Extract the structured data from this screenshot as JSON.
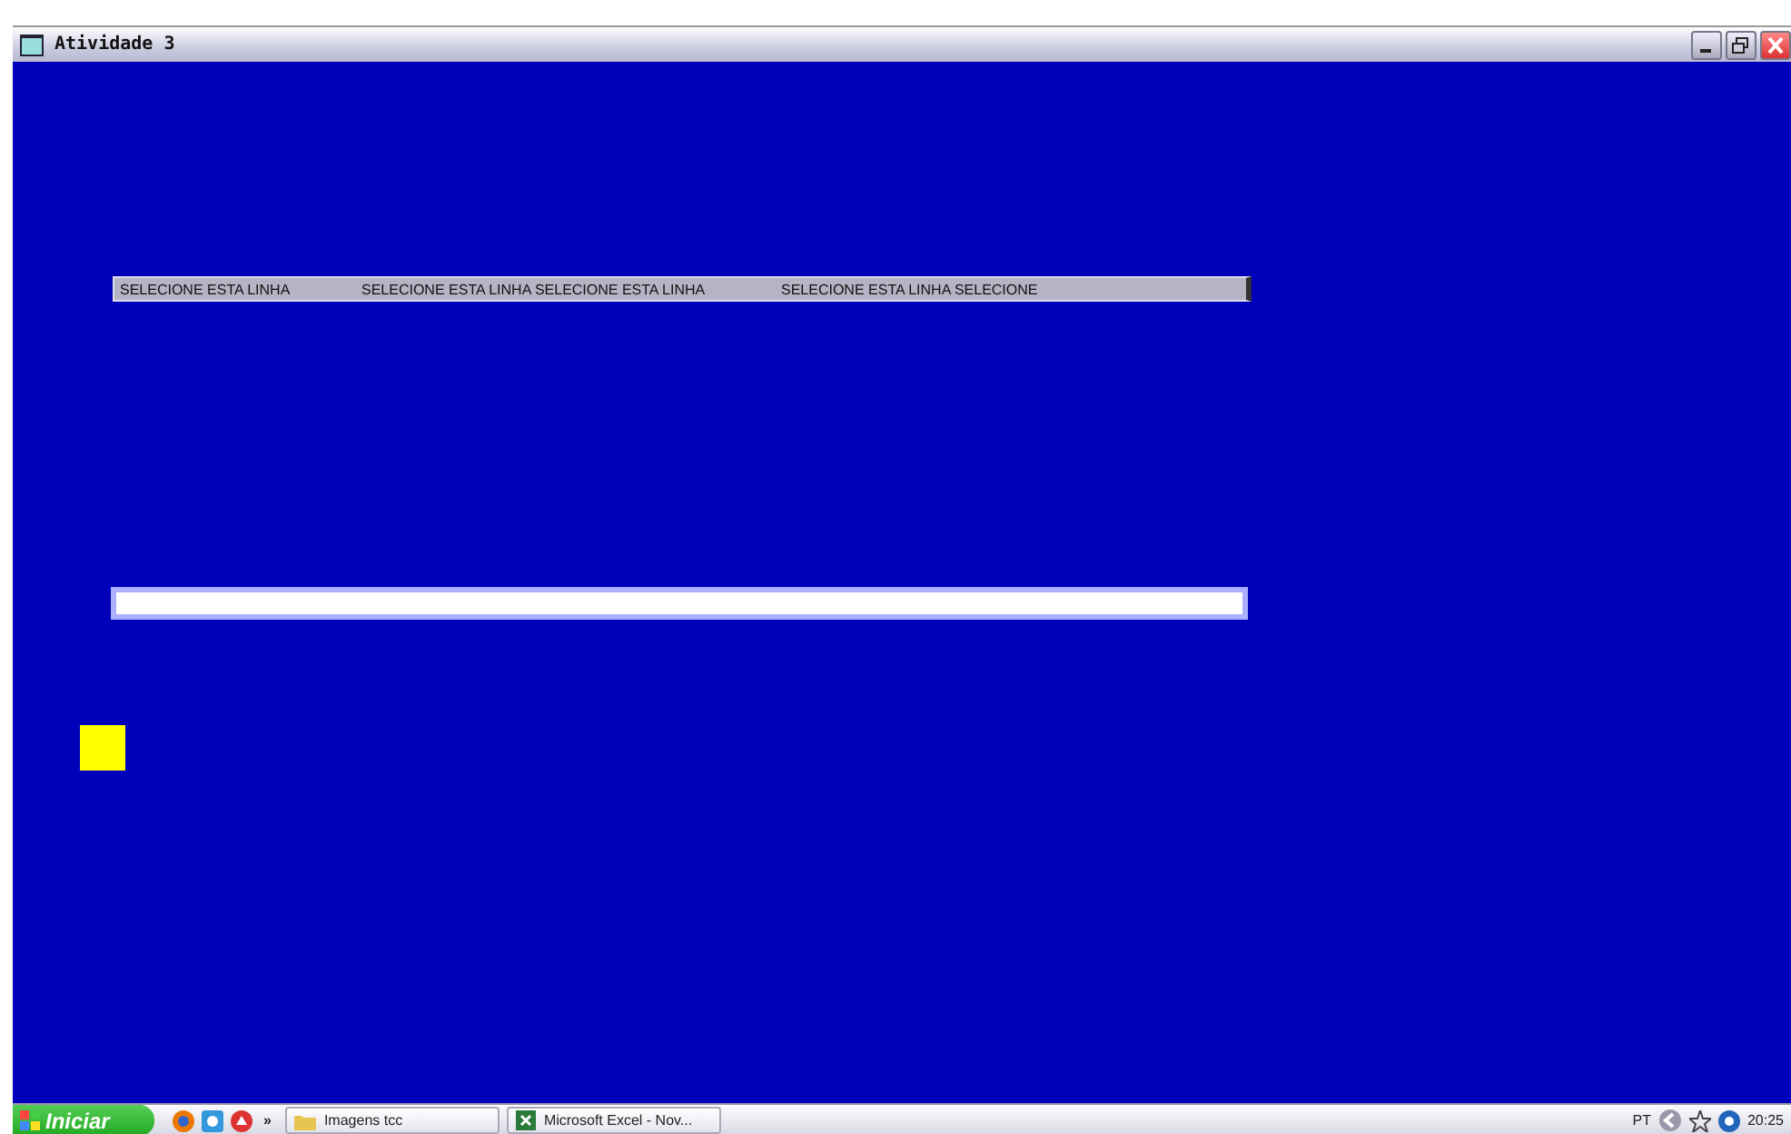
{
  "window": {
    "title": "Atividade 3"
  },
  "line": {
    "segments": [
      "SELECIONE ESTA LINHA",
      "SELECIONE ESTA LINHA SELECIONE ESTA LINHA",
      "SELECIONE ESTA LINHA SELECIONE"
    ]
  },
  "taskbar": {
    "start": "Iniciar",
    "overflow": "»",
    "tasks": [
      {
        "label": "Imagens tcc",
        "kind": "folder"
      },
      {
        "label": "Microsoft Excel - Nov...",
        "kind": "excel"
      }
    ],
    "language": "PT",
    "clock": "20:25"
  }
}
